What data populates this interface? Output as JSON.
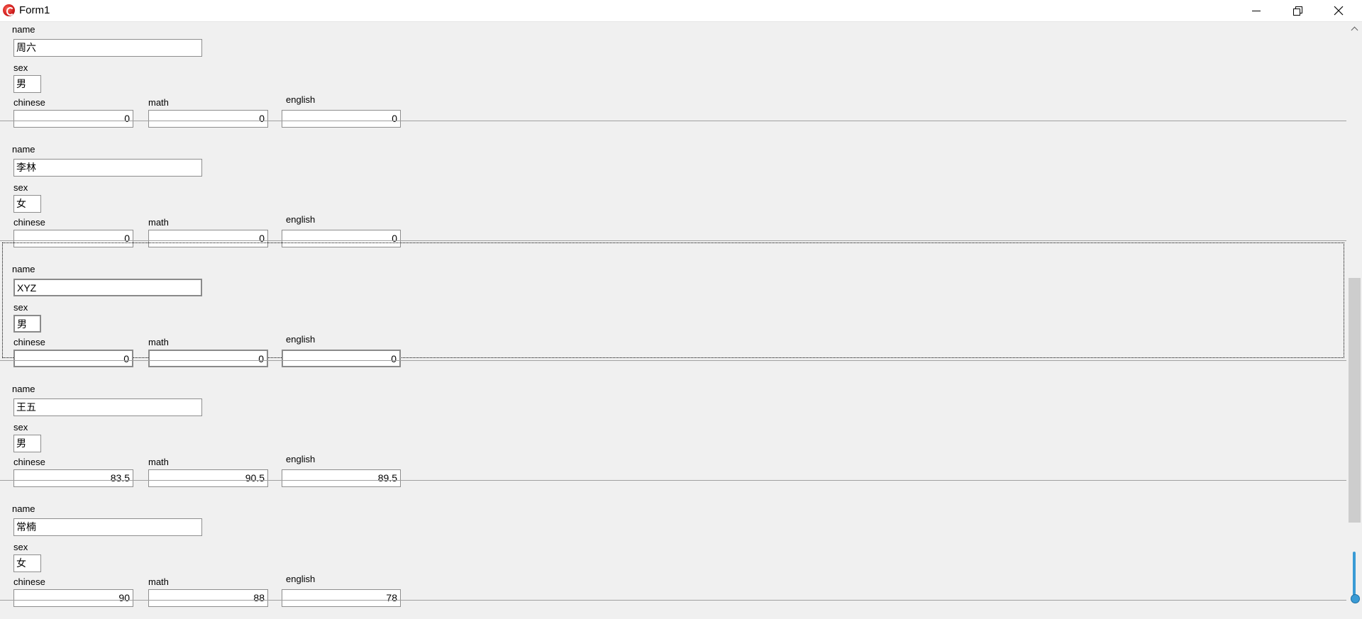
{
  "window": {
    "title": "Form1"
  },
  "labels": {
    "name": "name",
    "sex": "sex",
    "chinese": "chinese",
    "math": "math",
    "english": "english"
  },
  "records": [
    {
      "name": "周六",
      "sex": "男",
      "chinese": "0",
      "math": "0",
      "english": "0"
    },
    {
      "name": "李林",
      "sex": "女",
      "chinese": "0",
      "math": "0",
      "english": "0"
    },
    {
      "name": "XYZ",
      "sex": "男",
      "chinese": "0",
      "math": "0",
      "english": "0"
    },
    {
      "name": "王五",
      "sex": "男",
      "chinese": "83.5",
      "math": "90.5",
      "english": "89.5"
    },
    {
      "name": "常楠",
      "sex": "女",
      "chinese": "90",
      "math": "88",
      "english": "78"
    }
  ],
  "selected_record_index": 2,
  "colors": {
    "background": "#f0f0f0",
    "scroll_indicator": "#3a9bd5"
  },
  "icons": {
    "app": "app-icon",
    "minimize": "minimize-icon",
    "restore": "restore-icon",
    "close": "close-icon",
    "scroll_up": "chevron-up-icon"
  }
}
